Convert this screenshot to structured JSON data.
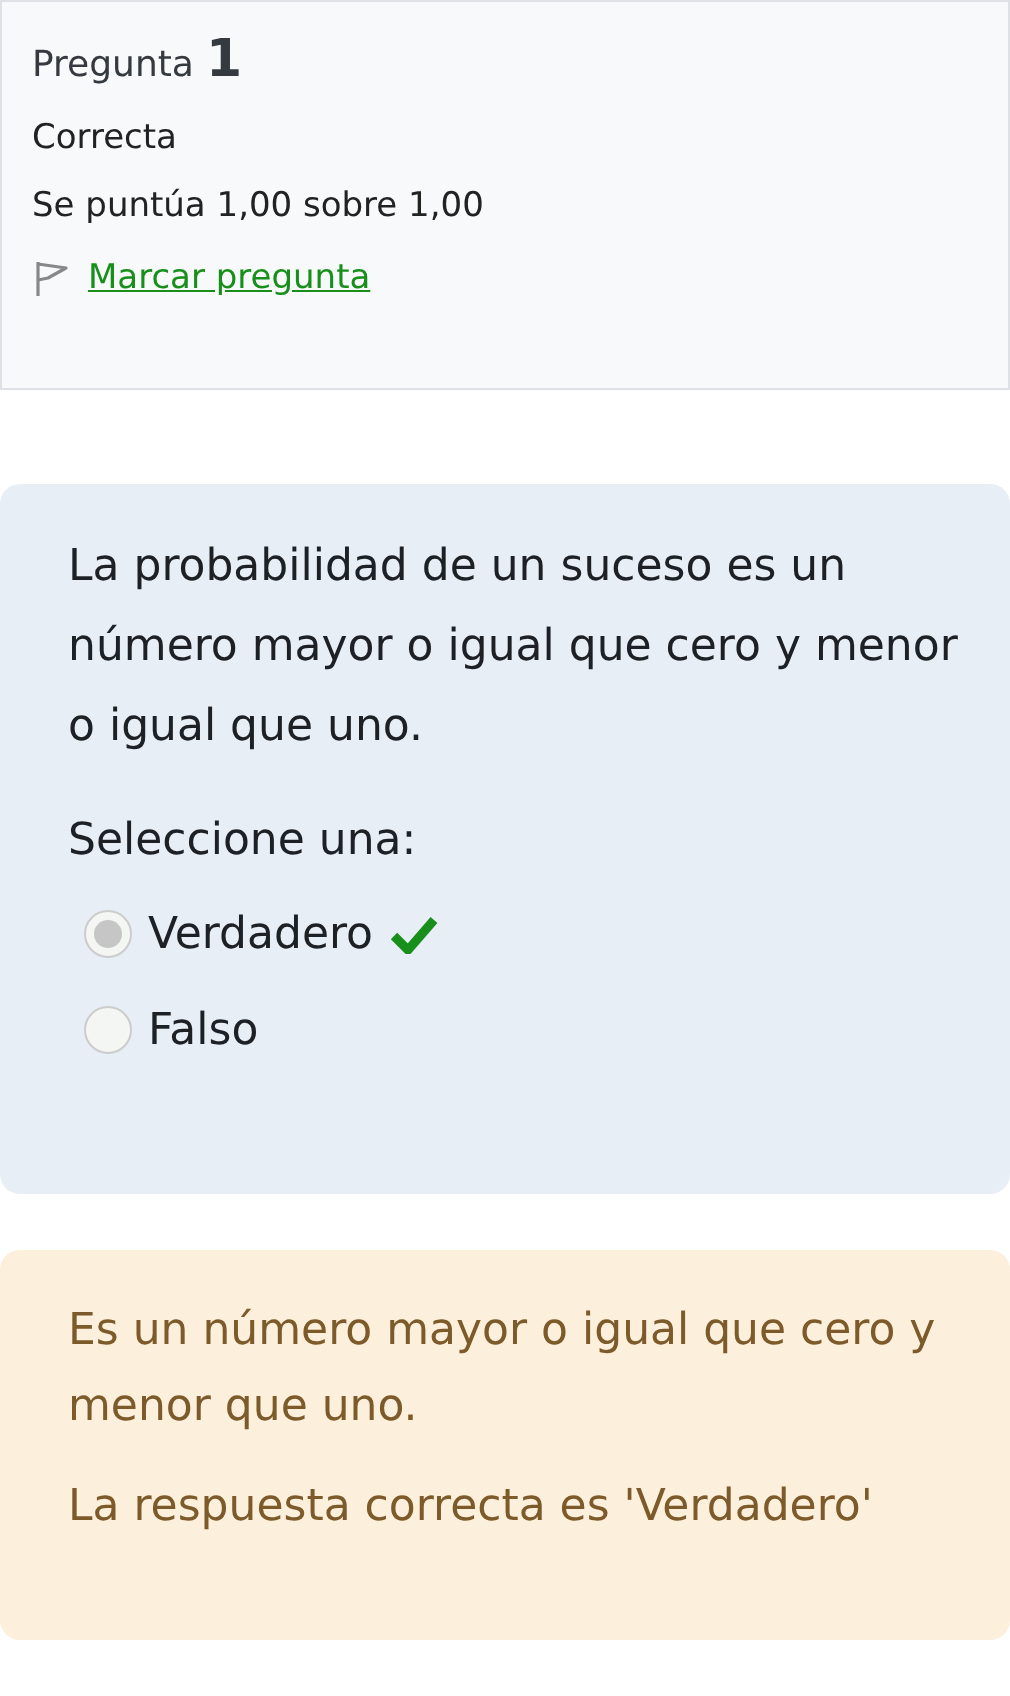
{
  "info": {
    "title": "Pregunta",
    "number": "1",
    "state": "Correcta",
    "grade": "Se puntúa 1,00 sobre 1,00",
    "flag_link": "Marcar pregunta",
    "flagged": false
  },
  "question": {
    "text": "La probabilidad de un suceso es un número mayor o igual que cero y menor o igual que uno.",
    "prompt": "Seleccione una:",
    "options": [
      {
        "label": "Verdadero",
        "selected": true,
        "correct": true
      },
      {
        "label": "Falso",
        "selected": false,
        "correct": false
      }
    ]
  },
  "feedback": {
    "specific": "Es un número mayor o igual que cero y menor que uno.",
    "right_answer": "La respuesta correcta es 'Verdadero'"
  }
}
